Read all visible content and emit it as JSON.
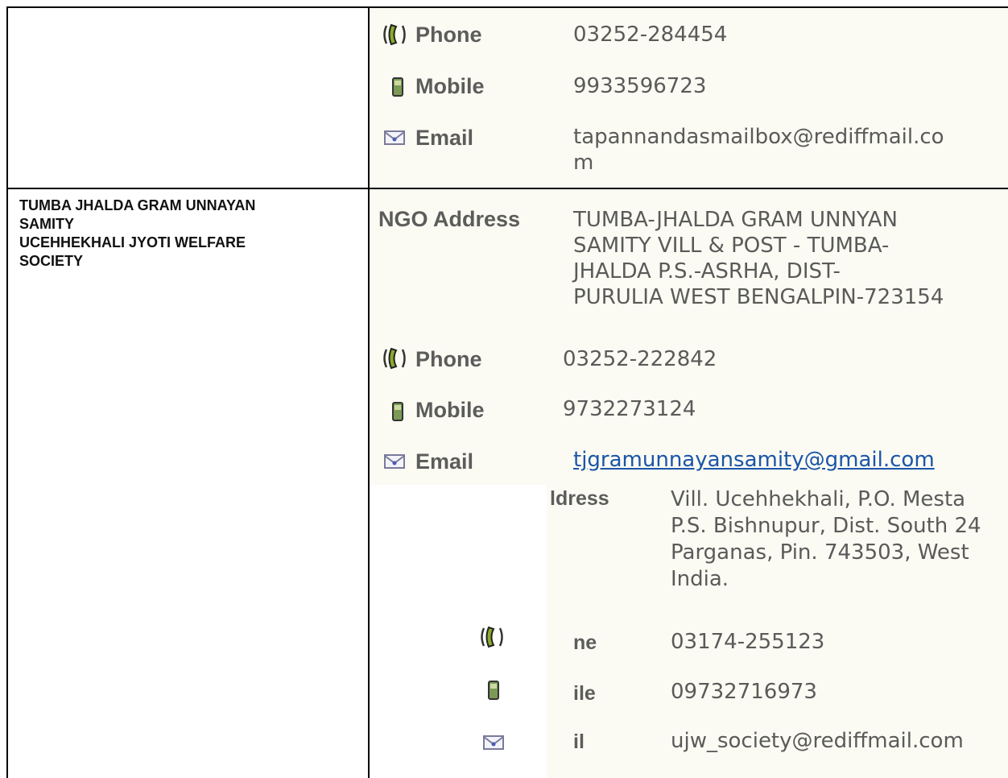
{
  "rows": [
    {
      "name": "",
      "contacts": [
        {
          "icon": "phone-icon",
          "label": "Phone",
          "value": "03252-284454"
        },
        {
          "icon": "mobile-icon",
          "label": "Mobile",
          "value": "9933596723"
        },
        {
          "icon": "email-icon",
          "label": "Email",
          "value_line1": "tapannandasmailbox@rediffmail.co",
          "value_line2": "m"
        }
      ]
    },
    {
      "name_line1": "TUMBA JHALDA GRAM UNNAYAN",
      "name_line2": "SAMITY",
      "name_line3": "UCEHHEKHALI JYOTI WELFARE",
      "name_line4": "SOCIETY",
      "address_label": "NGO Address",
      "address_lines": [
        "TUMBA-JHALDA GRAM UNNYAN",
        "SAMITY VILL & POST - TUMBA-",
        "JHALDA P.S.-ASRHA, DIST-",
        "PURULIA WEST BENGALPIN-723154"
      ],
      "contacts": [
        {
          "icon": "phone-icon",
          "label": "Phone",
          "value": "03252-222842"
        },
        {
          "icon": "mobile-icon",
          "label": "Mobile",
          "value": "9732273124"
        },
        {
          "icon": "email-icon",
          "label": "Email",
          "value": "tjgramunnayansamity@gmail.com"
        }
      ]
    },
    {
      "address_label_partial": "ldress",
      "address_lines": [
        "Vill. Ucehhekhali, P.O. Mesta",
        "P.S. Bishnupur, Dist. South 24",
        "Parganas, Pin. 743503, West",
        "India."
      ],
      "contacts": [
        {
          "icon": "phone-icon",
          "label_partial": "ne",
          "value": "03174-255123"
        },
        {
          "icon": "mobile-icon",
          "label_partial": "ile",
          "value": "09732716973"
        },
        {
          "icon": "email-icon",
          "label_partial": "il",
          "value": "ujw_society@rediffmail.com"
        }
      ]
    }
  ]
}
